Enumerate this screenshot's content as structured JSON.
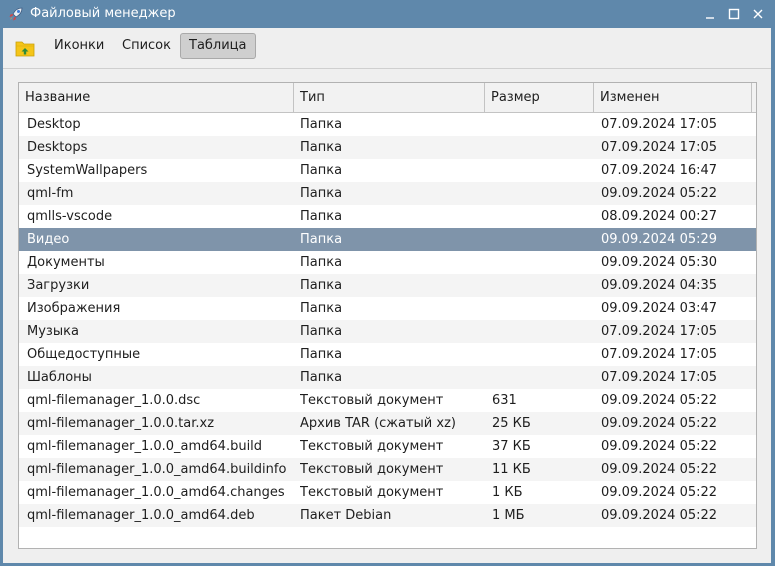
{
  "window": {
    "title": "Файловый менеджер",
    "icon": "rocket-icon",
    "controls": [
      "minimize-icon",
      "maximize-icon",
      "close-icon"
    ]
  },
  "toolbar": {
    "folder_icon": "folder-up-icon",
    "view_buttons": [
      "Иконки",
      "Список",
      "Таблица"
    ],
    "active_view": "Таблица"
  },
  "table": {
    "columns": [
      "Название",
      "Тип",
      "Размер",
      "Изменен"
    ],
    "selected_row": 5,
    "rows": [
      {
        "name": "Desktop",
        "type": "Папка",
        "size": "",
        "modified": "07.09.2024 17:05"
      },
      {
        "name": "Desktops",
        "type": "Папка",
        "size": "",
        "modified": "07.09.2024 17:05"
      },
      {
        "name": "SystemWallpapers",
        "type": "Папка",
        "size": "",
        "modified": "07.09.2024 16:47"
      },
      {
        "name": "qml-fm",
        "type": "Папка",
        "size": "",
        "modified": "09.09.2024 05:22"
      },
      {
        "name": "qmlls-vscode",
        "type": "Папка",
        "size": "",
        "modified": "08.09.2024 00:27"
      },
      {
        "name": "Видео",
        "type": "Папка",
        "size": "",
        "modified": "09.09.2024 05:29"
      },
      {
        "name": "Документы",
        "type": "Папка",
        "size": "",
        "modified": "09.09.2024 05:30"
      },
      {
        "name": "Загрузки",
        "type": "Папка",
        "size": "",
        "modified": "09.09.2024 04:35"
      },
      {
        "name": "Изображения",
        "type": "Папка",
        "size": "",
        "modified": "09.09.2024 03:47"
      },
      {
        "name": "Музыка",
        "type": "Папка",
        "size": "",
        "modified": "07.09.2024 17:05"
      },
      {
        "name": "Общедоступные",
        "type": "Папка",
        "size": "",
        "modified": "07.09.2024 17:05"
      },
      {
        "name": "Шаблоны",
        "type": "Папка",
        "size": "",
        "modified": "07.09.2024 17:05"
      },
      {
        "name": "qml-filemanager_1.0.0.dsc",
        "type": "Текстовый документ",
        "size": "631",
        "modified": "09.09.2024 05:22"
      },
      {
        "name": "qml-filemanager_1.0.0.tar.xz",
        "type": "Архив TAR (сжатый xz)",
        "size": "25 КБ",
        "modified": "09.09.2024 05:22"
      },
      {
        "name": "qml-filemanager_1.0.0_amd64.build",
        "type": "Текстовый документ",
        "size": "37 КБ",
        "modified": "09.09.2024 05:22"
      },
      {
        "name": "qml-filemanager_1.0.0_amd64.buildinfo",
        "type": "Текстовый документ",
        "size": "11 КБ",
        "modified": "09.09.2024 05:22"
      },
      {
        "name": "qml-filemanager_1.0.0_amd64.changes",
        "type": "Текстовый документ",
        "size": "1 КБ",
        "modified": "09.09.2024 05:22"
      },
      {
        "name": "qml-filemanager_1.0.0_amd64.deb",
        "type": "Пакет Debian",
        "size": "1 МБ",
        "modified": "09.09.2024 05:22"
      }
    ]
  },
  "colors": {
    "titlebar": "#5f88ab",
    "selection": "#7f94aa",
    "folder": "#f5c518"
  }
}
